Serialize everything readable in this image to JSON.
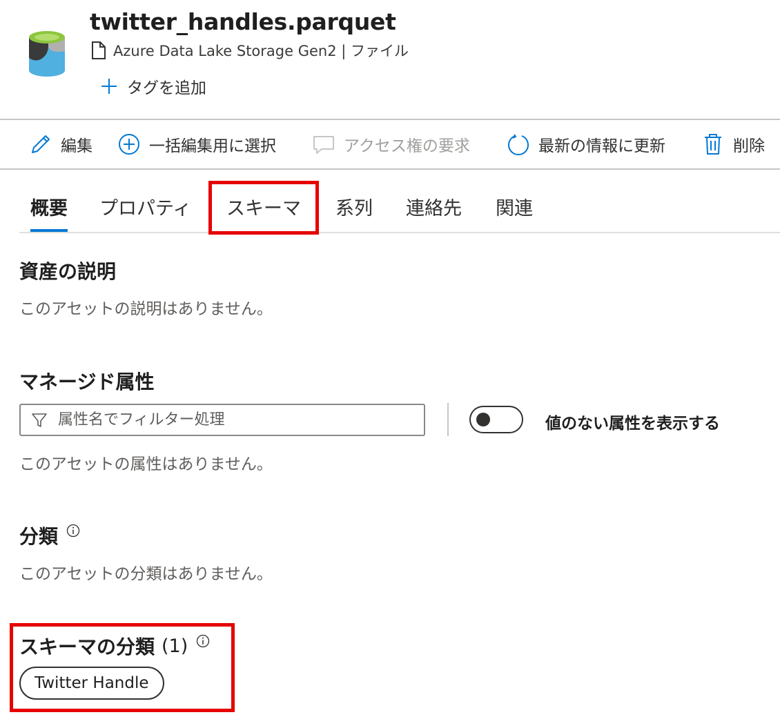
{
  "header": {
    "title": "twitter_handles.parquet",
    "subtitle": "Azure Data Lake Storage Gen2 | ファイル",
    "add_tag_label": "タグを追加",
    "asset_icon": "data-lake-cylinder-icon"
  },
  "toolbar": {
    "edit_label": "編集",
    "select_label": "一括編集用に選択",
    "access_label": "アクセス権の要求",
    "refresh_label": "最新の情報に更新",
    "delete_label": "削除"
  },
  "tabs": [
    {
      "label": "概要",
      "active": true
    },
    {
      "label": "プロパティ",
      "active": false
    },
    {
      "label": "スキーマ",
      "active": false
    },
    {
      "label": "系列",
      "active": false
    },
    {
      "label": "連絡先",
      "active": false
    },
    {
      "label": "関連",
      "active": false
    }
  ],
  "description": {
    "title": "資産の説明",
    "empty_text": "このアセットの説明はありません。"
  },
  "managed_attributes": {
    "title": "マネージド属性",
    "filter_placeholder": "属性名でフィルター処理",
    "filter_value": "",
    "toggle_label": "値のない属性を表示する",
    "toggle_on": false,
    "empty_text": "このアセットの属性はありません。"
  },
  "classification": {
    "title": "分類",
    "empty_text": "このアセットの分類はありません。"
  },
  "schema_classification": {
    "title": "スキーマの分類",
    "count": "(1)",
    "tags": [
      "Twitter Handle"
    ]
  },
  "colors": {
    "accent": "#0078d4",
    "highlight": "#e60000",
    "icon_green": "#8cc63f",
    "icon_dark": "#3a3a3a",
    "icon_blue": "#50b0e0"
  }
}
